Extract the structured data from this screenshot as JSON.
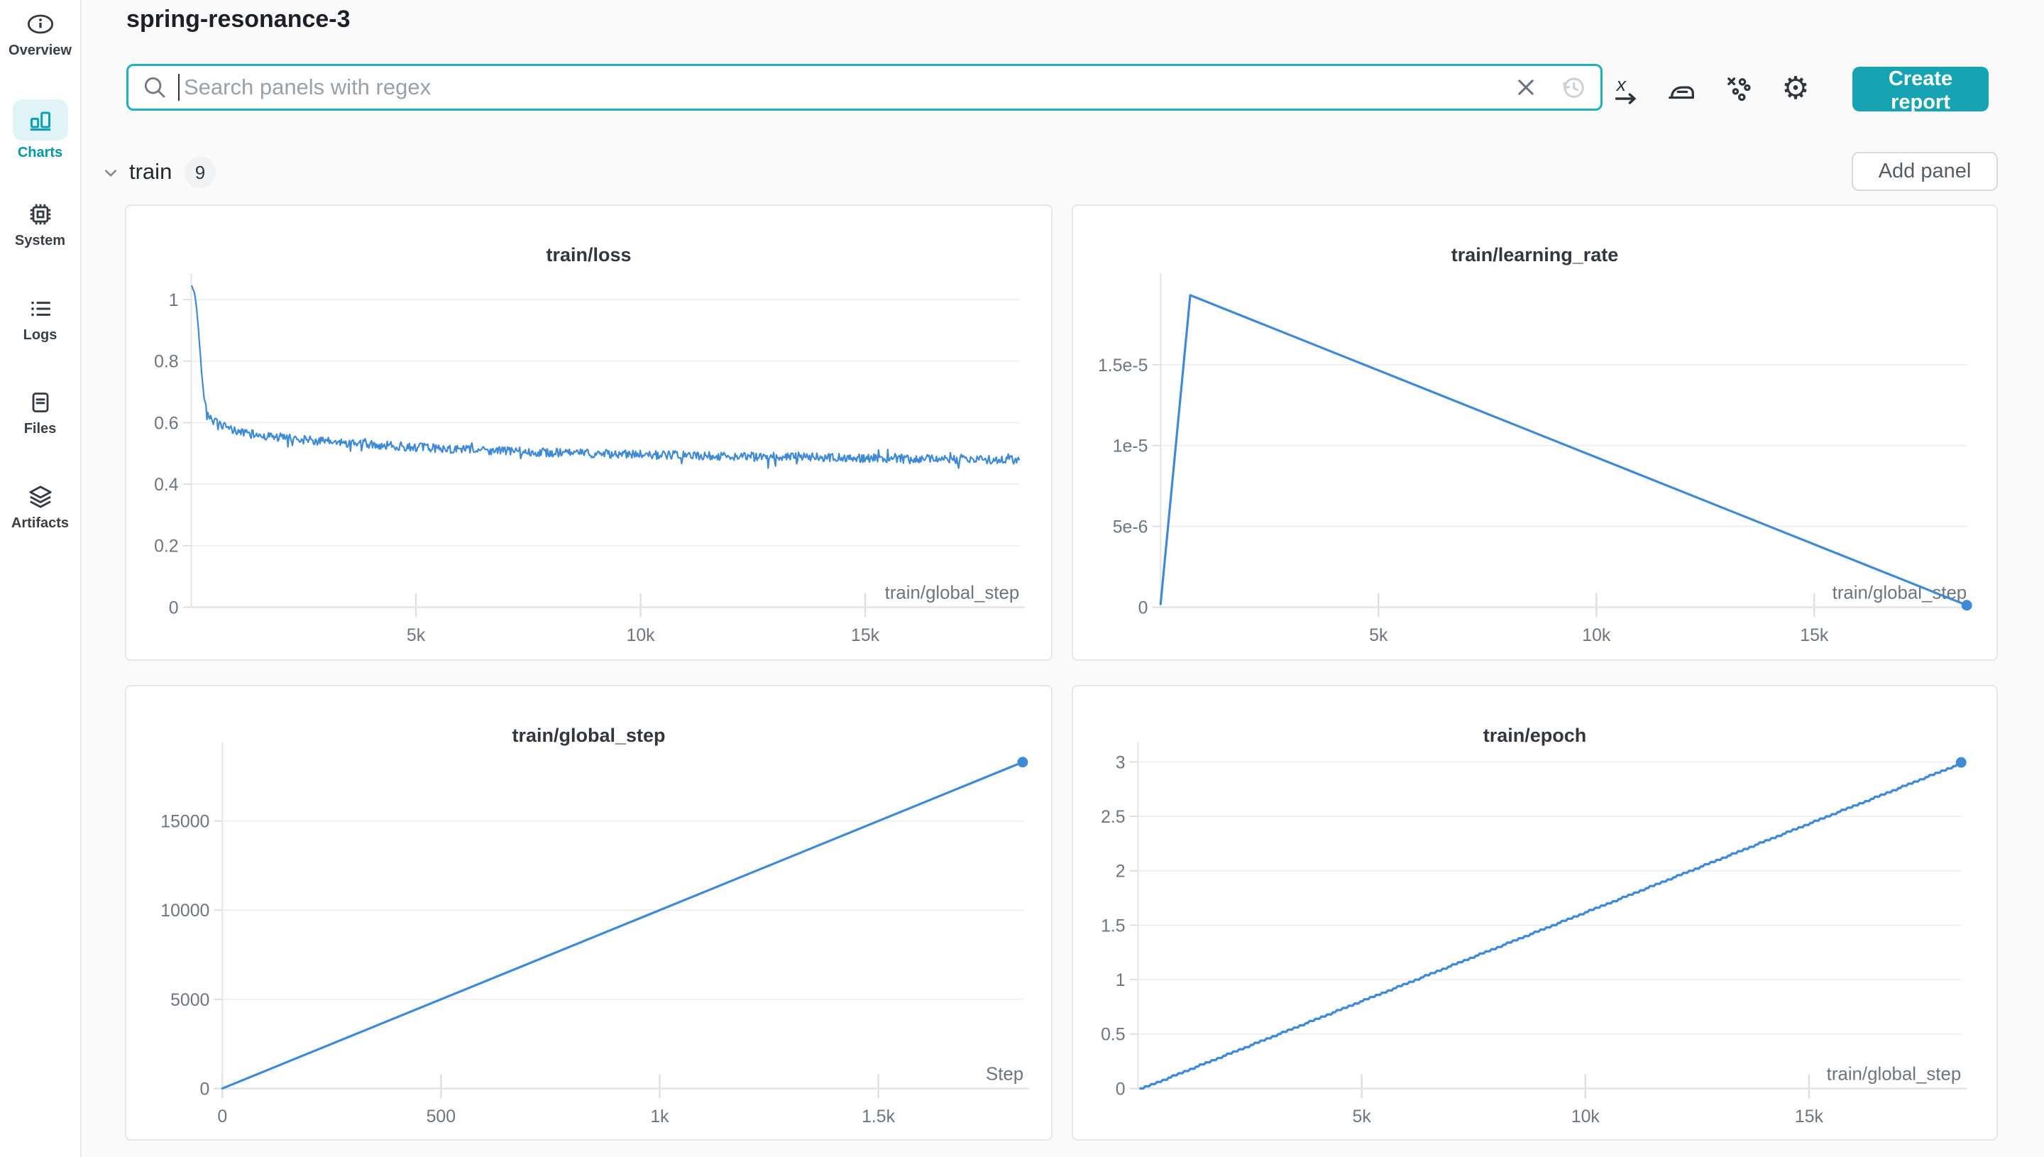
{
  "header": {
    "title": "spring-resonance-3"
  },
  "sidebar": {
    "items": [
      {
        "label": "Overview",
        "icon": "info-icon",
        "active": false
      },
      {
        "label": "Charts",
        "icon": "charts-icon",
        "active": true
      },
      {
        "label": "System",
        "icon": "cpu-icon",
        "active": false
      },
      {
        "label": "Logs",
        "icon": "logs-icon",
        "active": false
      },
      {
        "label": "Files",
        "icon": "files-icon",
        "active": false
      },
      {
        "label": "Artifacts",
        "icon": "artifacts-icon",
        "active": false
      }
    ]
  },
  "toolbar": {
    "search_placeholder": "Search panels with regex",
    "search_icons": [
      "search-icon",
      "clear-x-icon",
      "history-icon"
    ],
    "action_icons": [
      "x-axis-icon",
      "smoothing-icon",
      "outliers-icon",
      "settings-gear-icon"
    ],
    "create_report_label": "Create report",
    "accent_color": "#16a3b3",
    "search_border_color": "#1fb0c1"
  },
  "section": {
    "name": "train",
    "count": "9",
    "add_panel_label": "Add panel"
  },
  "chart_data": [
    {
      "type": "line",
      "title": "train/loss",
      "xlabel": "train/global_step",
      "xlim": [
        0,
        18430
      ],
      "ylim": [
        0,
        1.048
      ],
      "xticks": [
        [
          5000,
          "5k"
        ],
        [
          10000,
          "10k"
        ],
        [
          15000,
          "15k"
        ]
      ],
      "yticks": [
        [
          0,
          "0"
        ],
        [
          0.2,
          "0.2"
        ],
        [
          0.4,
          "0.4"
        ],
        [
          0.6,
          "0.6"
        ],
        [
          0.8,
          "0.8"
        ],
        [
          1,
          "1"
        ]
      ],
      "grid": true,
      "legend": "none",
      "series": [
        {
          "name": "spring-resonance-3",
          "color": "#3e8ad6",
          "anchors": [
            [
              0,
              1.045
            ],
            [
              60,
              1.03
            ],
            [
              100,
              0.995
            ],
            [
              140,
              0.94
            ],
            [
              180,
              0.865
            ],
            [
              220,
              0.785
            ],
            [
              260,
              0.715
            ],
            [
              300,
              0.663
            ],
            [
              340,
              0.64
            ],
            [
              400,
              0.622
            ],
            [
              500,
              0.605
            ],
            [
              650,
              0.592
            ],
            [
              800,
              0.582
            ],
            [
              1000,
              0.573
            ],
            [
              1300,
              0.563
            ],
            [
              1700,
              0.556
            ],
            [
              2200,
              0.549
            ],
            [
              2800,
              0.541
            ],
            [
              3500,
              0.533
            ],
            [
              4300,
              0.526
            ],
            [
              5200,
              0.519
            ],
            [
              6200,
              0.512
            ],
            [
              7300,
              0.506
            ],
            [
              8500,
              0.501
            ],
            [
              10000,
              0.496
            ],
            [
              11500,
              0.492
            ],
            [
              13000,
              0.489
            ],
            [
              14500,
              0.486
            ],
            [
              16000,
              0.483
            ],
            [
              17300,
              0.48
            ],
            [
              18430,
              0.478
            ]
          ],
          "noise_amp": 0.014,
          "samples": 900
        }
      ]
    },
    {
      "type": "line",
      "title": "train/learning_rate",
      "xlabel": "train/global_step",
      "xlim": [
        0,
        18500
      ],
      "ylim": [
        0,
        1.994e-05
      ],
      "xticks": [
        [
          5000,
          "5k"
        ],
        [
          10000,
          "10k"
        ],
        [
          15000,
          "15k"
        ]
      ],
      "yticks": [
        [
          0,
          "0"
        ],
        [
          5e-06,
          "5e-6"
        ],
        [
          1e-05,
          "1e-5"
        ],
        [
          1.5e-05,
          "1.5e-5"
        ]
      ],
      "grid": true,
      "legend": "none",
      "series": [
        {
          "name": "spring-resonance-3",
          "color": "#3e8ad6",
          "points_xy": [
            [
              0,
              2e-07
            ],
            [
              680,
              1.93e-05
            ],
            [
              18500,
              1.2e-07
            ]
          ],
          "end_marker": true
        }
      ]
    },
    {
      "type": "line",
      "title": "train/global_step",
      "xlabel": "Step",
      "xlim": [
        0,
        1832
      ],
      "ylim": [
        0,
        18790
      ],
      "xticks": [
        [
          0,
          "0"
        ],
        [
          500,
          "500"
        ],
        [
          1000,
          "1k"
        ],
        [
          1500,
          "1.5k"
        ]
      ],
      "yticks": [
        [
          0,
          "0"
        ],
        [
          5000,
          "5000"
        ],
        [
          10000,
          "10000"
        ],
        [
          15000,
          "15000"
        ]
      ],
      "grid": true,
      "legend": "none",
      "series": [
        {
          "name": "spring-resonance-3",
          "color": "#3e8ad6",
          "points_xy": [
            [
              0,
              0
            ],
            [
              1830,
              18300
            ]
          ],
          "end_marker": true
        }
      ]
    },
    {
      "type": "line",
      "title": "train/epoch",
      "xlabel": "train/global_step",
      "xlim": [
        0,
        18400
      ],
      "ylim": [
        0,
        3.078
      ],
      "xticks": [
        [
          5000,
          "5k"
        ],
        [
          10000,
          "10k"
        ],
        [
          15000,
          "15k"
        ]
      ],
      "yticks": [
        [
          0,
          "0"
        ],
        [
          0.5,
          "0.5"
        ],
        [
          1,
          "1"
        ],
        [
          1.5,
          "1.5"
        ],
        [
          2,
          "2"
        ],
        [
          2.5,
          "2.5"
        ],
        [
          3,
          "3"
        ]
      ],
      "grid": true,
      "legend": "none",
      "series": [
        {
          "name": "spring-resonance-3",
          "color": "#3e8ad6",
          "points_xy": [
            [
              30,
              0
            ],
            [
              18400,
              2.995
            ]
          ],
          "stepped": true,
          "end_marker": true
        }
      ]
    }
  ]
}
